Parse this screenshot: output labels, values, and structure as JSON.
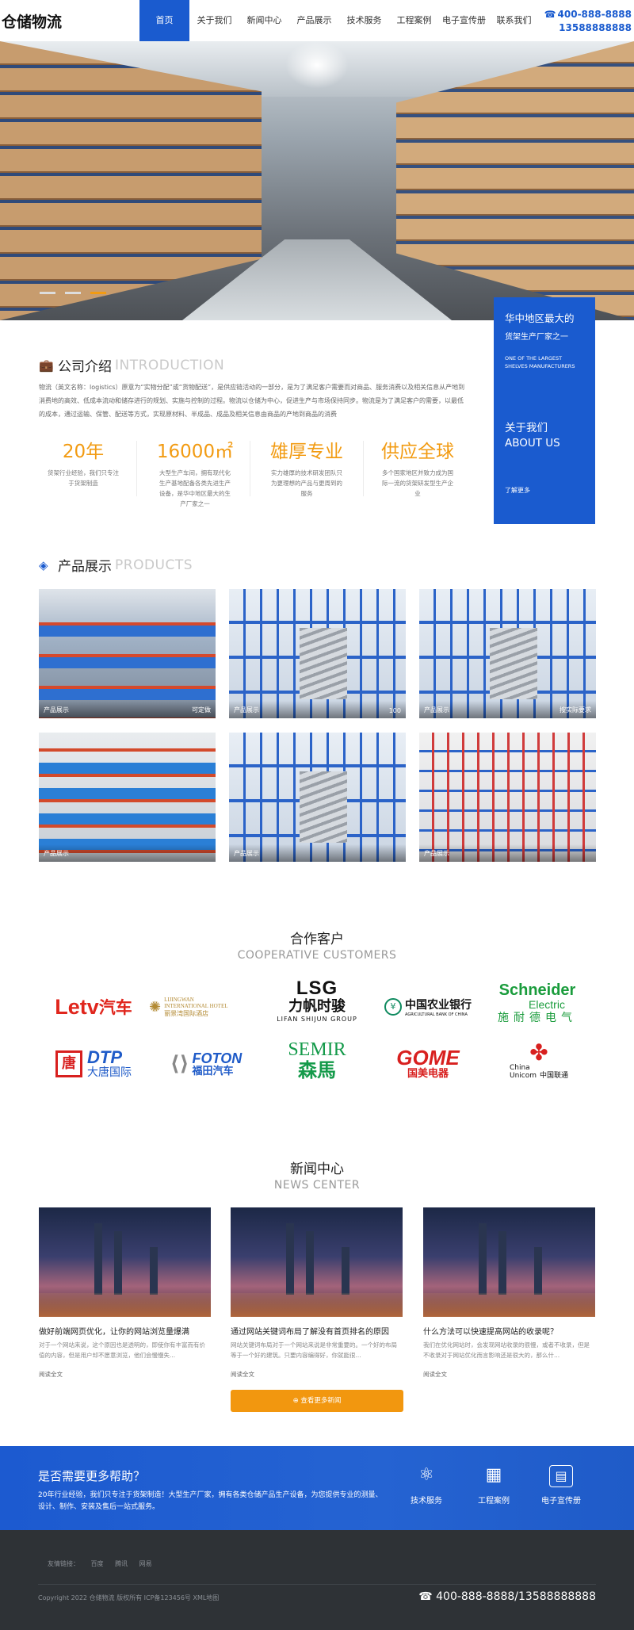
{
  "header": {
    "logo": "仓储物流",
    "nav": [
      "首页",
      "关于我们",
      "新闻中心",
      "产品展示",
      "技术服务",
      "工程案例",
      "电子宣传册",
      "联系我们"
    ],
    "phone1": "400-888-8888",
    "phone2": "13588888888"
  },
  "intro": {
    "title_cn": "公司介绍",
    "title_en": "INTRODUCTION",
    "text": "物流（英文名称：logistics）原意为“实物分配”或“货物配送”，是供应链活动的一部分，是为了满足客户需要而对商品、服务消费以及相关信息从产地到消费地的高效、低成本流动和储存进行的规划、实施与控制的过程。物流以仓储为中心，促进生产与市场保持同步。物流是为了满足客户的需要，以最低的成本，通过运输、保管、配送等方式，实现原材料、半成品、成品及相关信息由商品的产地到商品的消费",
    "stats": [
      {
        "num": "20年",
        "desc": "货架行业经验，我们只专注于货架制造"
      },
      {
        "num": "16000㎡",
        "desc": "大型生产车间，拥有现代化生产基地配备各类先进生产设备，是华中地区最大的生产厂家之一"
      },
      {
        "num": "雄厚专业",
        "desc": "实力雄厚的技术研发团队只为更理想的产品与更周到的服务"
      },
      {
        "num": "供应全球",
        "desc": "多个国家地区并致力成为国际一流的货架研发型生产企业"
      }
    ],
    "card": {
      "t1": "华中地区最大的",
      "t2": "货架生产厂家之一",
      "t3": "ONE OF THE LARGEST SHELVES MANUFACTURERS",
      "t4a": "关于我们",
      "t4b": "ABOUT US",
      "t5": "了解更多"
    }
  },
  "products": {
    "title_cn": "产品展示",
    "title_en": "PRODUCTS",
    "items": [
      {
        "label": "产品展示",
        "tag": "可定做"
      },
      {
        "label": "产品展示",
        "tag": "100"
      },
      {
        "label": "产品展示",
        "tag": "按实际要求"
      },
      {
        "label": "产品展示",
        "tag": ""
      },
      {
        "label": "产品展示",
        "tag": ""
      },
      {
        "label": "产品展示",
        "tag": ""
      }
    ]
  },
  "customers": {
    "title_cn": "合作客户",
    "title_en": "COOPERATIVE CUSTOMERS",
    "logos": [
      {
        "a": "Letv",
        "b": "汽车"
      },
      {
        "a": "LIJINGWAN",
        "b": "INTERNATIONAL HOTEL",
        "c": "丽景湾国际酒店"
      },
      {
        "a": "LSG",
        "b": "力帆时骏",
        "c": "LIFAN SHIJUN GROUP"
      },
      {
        "a": "中国农业银行",
        "b": "AGRICULTURAL BANK OF CHINA"
      },
      {
        "a": "Schneider",
        "b": "Electric",
        "c": "施耐德电气"
      },
      {
        "a": "DTP",
        "b": "大唐国际"
      },
      {
        "a": "FOTON",
        "b": "福田汽车"
      },
      {
        "a": "SEMIR",
        "b": "森馬"
      },
      {
        "a": "GOME",
        "b": "国美电器"
      },
      {
        "a": "China",
        "b": "Unicom",
        "c": "中国联通"
      }
    ]
  },
  "news": {
    "title_cn": "新闻中心",
    "title_en": "NEWS CENTER",
    "items": [
      {
        "title": "做好前端网页优化，让你的网站浏览量爆满",
        "summary": "对于一个网站来说，这个原因也是透明的，即使你有丰富而有价值的内容，但是用户却不愿意浏览，他们会慢慢失...",
        "more": "阅读全文"
      },
      {
        "title": "通过网站关键词布局了解没有首页排名的原因",
        "summary": "网站关键词布局对于一个网站来说是非常重要的。一个好的布局等于一个好的建筑。只要内容编得好，你就能很...",
        "more": "阅读全文"
      },
      {
        "title": "什么方法可以快速提高网站的收录呢？",
        "summary": "我们在优化网站时，会发现网站收录的很慢，或者不收录，但是不收录对于网站优化而言影响还是很大的，那么什...",
        "more": "阅读全文"
      }
    ],
    "button": "查看更多新闻"
  },
  "help": {
    "question": "是否需要更多帮助？",
    "desc": "20年行业经验，我们只专注于货架制造！大型生产厂家，拥有各类仓储产品生产设备，为您提供专业的测量、设计、制作、安装及售后一站式服务。",
    "items": [
      "技术服务",
      "工程案例",
      "电子宣传册"
    ]
  },
  "footer": {
    "links_label": "友情链接：",
    "links": [
      "百度",
      "腾讯",
      "网易"
    ],
    "copyright": "Copyright 2022 仓储物流 版权所有  ICP备123456号  XML地图",
    "phone": "400-888-8888/13588888888"
  }
}
